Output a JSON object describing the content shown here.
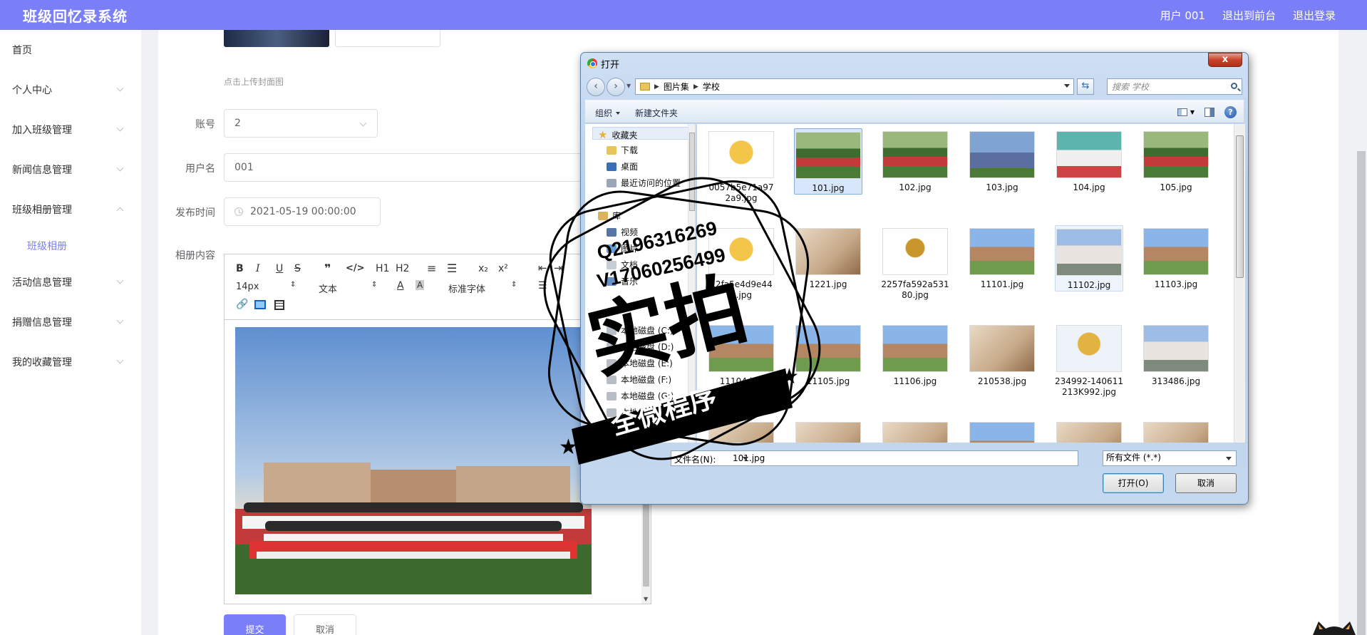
{
  "header": {
    "title": "班级回忆录系统",
    "user": "用户 001",
    "to_front": "退出到前台",
    "logout": "退出登录"
  },
  "sidebar": {
    "items": [
      {
        "label": "首页"
      },
      {
        "label": "个人中心"
      },
      {
        "label": "加入班级管理"
      },
      {
        "label": "新闻信息管理"
      },
      {
        "label": "班级相册管理"
      },
      {
        "label": "班级相册"
      },
      {
        "label": "活动信息管理"
      },
      {
        "label": "捐赠信息管理"
      },
      {
        "label": "我的收藏管理"
      }
    ]
  },
  "form": {
    "cover_hint": "点击上传封面图",
    "account_label": "账号",
    "account_value": "2",
    "username_label": "用户名",
    "username_value": "001",
    "publish_label": "发布时间",
    "publish_value": "2021-05-19 00:00:00",
    "content_label": "相册内容",
    "submit": "提交",
    "cancel": "取消"
  },
  "editor": {
    "toolbar_row1": [
      "B",
      "I",
      "U",
      "S",
      "❞",
      "</>",
      "H1",
      "H2",
      "≡",
      "☰",
      "x₂",
      "x²"
    ],
    "font_size": "14px",
    "text_style": "文本",
    "font_family": "标准字体"
  },
  "dialog": {
    "title": "打开",
    "close": "x",
    "breadcrumb": [
      "图片集",
      "学校"
    ],
    "search_placeholder": "搜索 学校",
    "organize": "组织",
    "new_folder": "新建文件夹",
    "help": "?",
    "tree": [
      {
        "label": "收藏夹",
        "icon": "star-icon"
      },
      {
        "label": "下载",
        "icon": "download-folder-icon"
      },
      {
        "label": "桌面",
        "icon": "desktop-icon"
      },
      {
        "label": "最近访问的位置",
        "icon": "recent-icon"
      },
      {
        "label": "库",
        "icon": "library-icon"
      },
      {
        "label": "视频",
        "icon": "video-icon"
      },
      {
        "label": "图片",
        "icon": "picture-icon"
      },
      {
        "label": "文档",
        "icon": "document-icon"
      },
      {
        "label": "音乐",
        "icon": "music-icon"
      },
      {
        "label": "本地磁盘 (C:)",
        "icon": "drive-icon"
      },
      {
        "label": "本地磁盘 (D:)",
        "icon": "drive-icon"
      },
      {
        "label": "本地磁盘 (E:)",
        "icon": "drive-icon"
      },
      {
        "label": "本地磁盘 (F:)",
        "icon": "drive-icon"
      },
      {
        "label": "本地磁盘 (G:)",
        "icon": "drive-icon"
      },
      {
        "label": "本地磁盘 (H:)",
        "icon": "drive-icon"
      }
    ],
    "files": [
      {
        "name": "0057b5e71a972a9.jpg",
        "kind": "trophy"
      },
      {
        "name": "101.jpg",
        "kind": "class",
        "selected": true
      },
      {
        "name": "102.jpg",
        "kind": "class"
      },
      {
        "name": "103.jpg",
        "kind": "crowd"
      },
      {
        "name": "104.jpg",
        "kind": "field"
      },
      {
        "name": "105.jpg",
        "kind": "class"
      },
      {
        "name": "12fa5e4d9e44b.jpg",
        "kind": "trophy"
      },
      {
        "name": "1221.jpg",
        "kind": "room"
      },
      {
        "name": "2257fa592a53180.jpg",
        "kind": "trophy2"
      },
      {
        "name": "11101.jpg",
        "kind": "campus"
      },
      {
        "name": "11102.jpg",
        "kind": "building",
        "hover": true
      },
      {
        "name": "11103.jpg",
        "kind": "campus"
      },
      {
        "name": "11104.jpg",
        "kind": "campus"
      },
      {
        "name": "11105.jpg",
        "kind": "campus"
      },
      {
        "name": "11106.jpg",
        "kind": "campus"
      },
      {
        "name": "210538.jpg",
        "kind": "room"
      },
      {
        "name": "234992-140611213K992.jpg",
        "kind": "trophy3"
      },
      {
        "name": "313486.jpg",
        "kind": "building"
      },
      {
        "name": "",
        "kind": "room"
      },
      {
        "name": "",
        "kind": "room"
      },
      {
        "name": "",
        "kind": "room"
      },
      {
        "name": "",
        "kind": "campus"
      },
      {
        "name": "",
        "kind": "room"
      },
      {
        "name": "",
        "kind": "room"
      }
    ],
    "filename_label": "文件名(N):",
    "filename_value": "101.jpg",
    "file_type": "所有文件 (*.*)",
    "open": "打开(O)",
    "cancel": "取消"
  },
  "watermark": {
    "line1": "Q2196316269",
    "line2": "V17060256499",
    "main": "实拍",
    "banner": "全微程序"
  },
  "colors": {
    "accent": "#7b7ff7",
    "selected_file": "#d8e6fb"
  }
}
